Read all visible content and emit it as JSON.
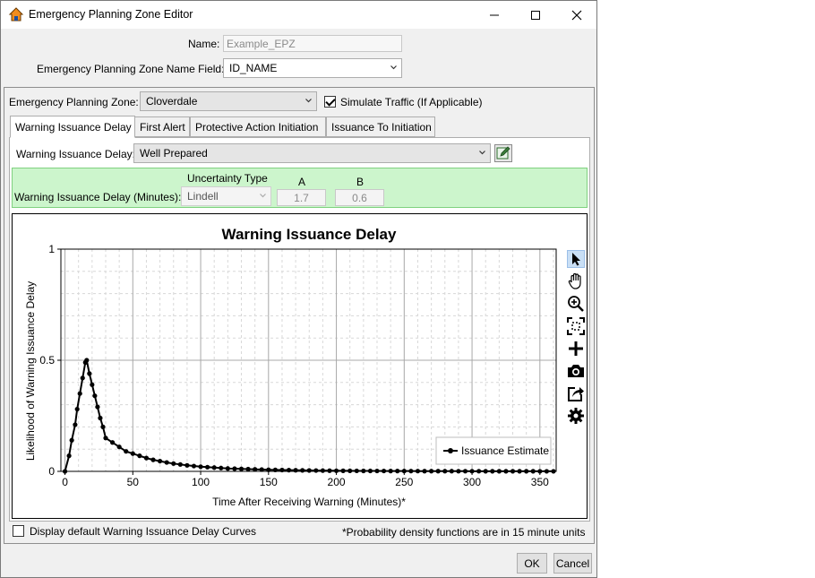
{
  "window": {
    "title": "Emergency Planning Zone Editor"
  },
  "form": {
    "name_label": "Name:",
    "name_value": "Example_EPZ",
    "name_field_label": "Emergency Planning Zone Name Field:",
    "name_field_value": "ID_NAME"
  },
  "zone": {
    "label": "Emergency Planning Zone:",
    "value": "Cloverdale",
    "simulate_traffic_label": "Simulate Traffic (If Applicable)",
    "simulate_traffic_checked": true
  },
  "tabs": [
    {
      "label": "Warning Issuance Delay",
      "active": true
    },
    {
      "label": "First Alert",
      "active": false
    },
    {
      "label": "Protective Action Initiation",
      "active": false
    },
    {
      "label": "Issuance To Initiation",
      "active": false
    }
  ],
  "delay": {
    "label": "Warning Issuance Delay:",
    "value": "Well Prepared",
    "minutes_label": "Warning Issuance Delay (Minutes):",
    "uncertainty_header": "Uncertainty Type",
    "uncertainty_value": "Lindell",
    "a_header": "A",
    "a_value": "1.7",
    "b_header": "B",
    "b_value": "0.6"
  },
  "footer": {
    "display_default_label": "Display default Warning Issuance Delay Curves",
    "note": "*Probability density functions are in 15 minute units",
    "ok_label": "OK",
    "cancel_label": "Cancel"
  },
  "toolbar_icons": [
    "pointer-icon",
    "pan-hand-icon",
    "zoom-in-icon",
    "zoom-fit-icon",
    "add-icon",
    "camera-icon",
    "export-icon",
    "settings-icon"
  ],
  "chart_data": {
    "type": "line",
    "title": "Warning Issuance Delay",
    "xlabel": "Time After Receiving Warning (Minutes)*",
    "ylabel": "Likelihood of Warning Issuance Delay",
    "xlim": [
      -3,
      362
    ],
    "ylim": [
      0,
      1
    ],
    "xticks": [
      0,
      50,
      100,
      150,
      200,
      250,
      300,
      350
    ],
    "yticks": [
      0,
      0.5,
      1
    ],
    "yticklabels": [
      "0",
      "0.5",
      "1"
    ],
    "grid": true,
    "legend_position": "bottom-right",
    "series": [
      {
        "name": "Issuance Estimate",
        "color": "#000000",
        "marker": "circle",
        "x": [
          0,
          3,
          5,
          7.5,
          9,
          11,
          13,
          15,
          16,
          18,
          20,
          22,
          24,
          26,
          28,
          30,
          35,
          40,
          45,
          50,
          55,
          60,
          65,
          70,
          75,
          80,
          85,
          90,
          95,
          100,
          105,
          110,
          115,
          120,
          125,
          130,
          135,
          140,
          145,
          150,
          155,
          160,
          165,
          170,
          175,
          180,
          185,
          190,
          195,
          200,
          205,
          210,
          215,
          220,
          225,
          230,
          235,
          240,
          245,
          250,
          255,
          260,
          265,
          270,
          275,
          280,
          285,
          290,
          295,
          300,
          305,
          310,
          315,
          320,
          325,
          330,
          335,
          340,
          345,
          350,
          355,
          360
        ],
        "y": [
          0,
          0.07,
          0.14,
          0.21,
          0.28,
          0.35,
          0.42,
          0.49,
          0.5,
          0.44,
          0.39,
          0.34,
          0.29,
          0.24,
          0.2,
          0.15,
          0.13,
          0.11,
          0.09,
          0.08,
          0.07,
          0.06,
          0.052,
          0.046,
          0.04,
          0.035,
          0.031,
          0.027,
          0.024,
          0.021,
          0.019,
          0.017,
          0.015,
          0.013,
          0.012,
          0.011,
          0.01,
          0.009,
          0.008,
          0.007,
          0.0065,
          0.006,
          0.0055,
          0.005,
          0.0045,
          0.004,
          0.0037,
          0.0034,
          0.0031,
          0.0028,
          0.0026,
          0.0024,
          0.0022,
          0.002,
          0.0019,
          0.0018,
          0.0017,
          0.0016,
          0.0015,
          0.0014,
          0.0013,
          0.0012,
          0.0011,
          0.001,
          0.001,
          0.0009,
          0.0009,
          0.0008,
          0.0008,
          0.0007,
          0.0007,
          0.0006,
          0.0006,
          0.0005,
          0.0005,
          0.0005,
          0.0004,
          0.0004,
          0.0004,
          0.0003,
          0.0003,
          0.0003
        ]
      }
    ]
  }
}
